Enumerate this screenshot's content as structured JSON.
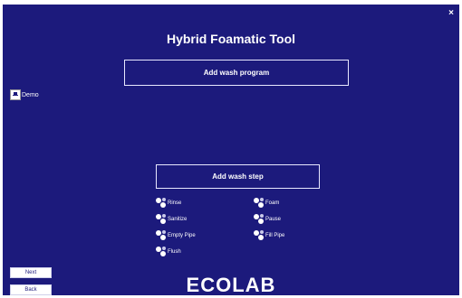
{
  "window": {
    "close_symbol": "×",
    "title": "Hybrid Foamatic Tool"
  },
  "actions": {
    "add_wash_program": "Add wash program",
    "add_wash_step": "Add wash step"
  },
  "programs": [
    {
      "label": "Demo",
      "icon": "program-icon"
    }
  ],
  "steps": [
    {
      "label": "Rinse",
      "icon": "step-icon"
    },
    {
      "label": "Foam",
      "icon": "step-icon"
    },
    {
      "label": "Sanitize",
      "icon": "step-icon"
    },
    {
      "label": "Pause",
      "icon": "step-icon"
    },
    {
      "label": "Empty Pipe",
      "icon": "step-icon"
    },
    {
      "label": "Fill Pipe",
      "icon": "step-icon"
    },
    {
      "label": "Flush",
      "icon": "step-icon"
    }
  ],
  "nav": {
    "next": "Next",
    "back": "Back"
  },
  "brand": {
    "logo_text": "ECOLAB"
  },
  "colors": {
    "background": "#1c1a7c",
    "foreground": "#ffffff"
  }
}
